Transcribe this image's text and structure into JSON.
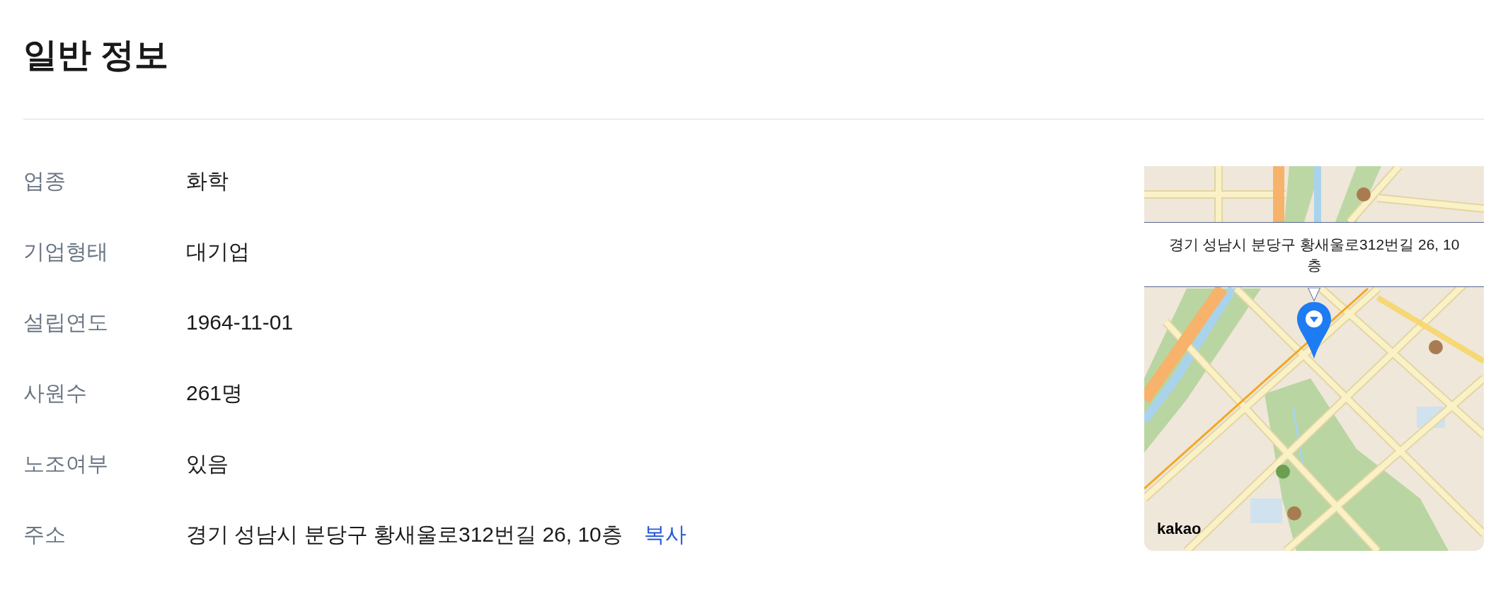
{
  "section": {
    "title": "일반 정보"
  },
  "fields": [
    {
      "label": "업종",
      "value": "화학"
    },
    {
      "label": "기업형태",
      "value": "대기업"
    },
    {
      "label": "설립연도",
      "value": "1964-11-01"
    },
    {
      "label": "사원수",
      "value": "261명"
    },
    {
      "label": "노조여부",
      "value": "있음"
    },
    {
      "label": "주소",
      "value": "경기 성남시 분당구 황새울로312번길 26, 10층",
      "action": "복사"
    }
  ],
  "map": {
    "info_window": {
      "lines": [
        "경기 성남시 분당구 황새울로312번길 26, 10",
        "층"
      ]
    },
    "logo": "kakao"
  }
}
